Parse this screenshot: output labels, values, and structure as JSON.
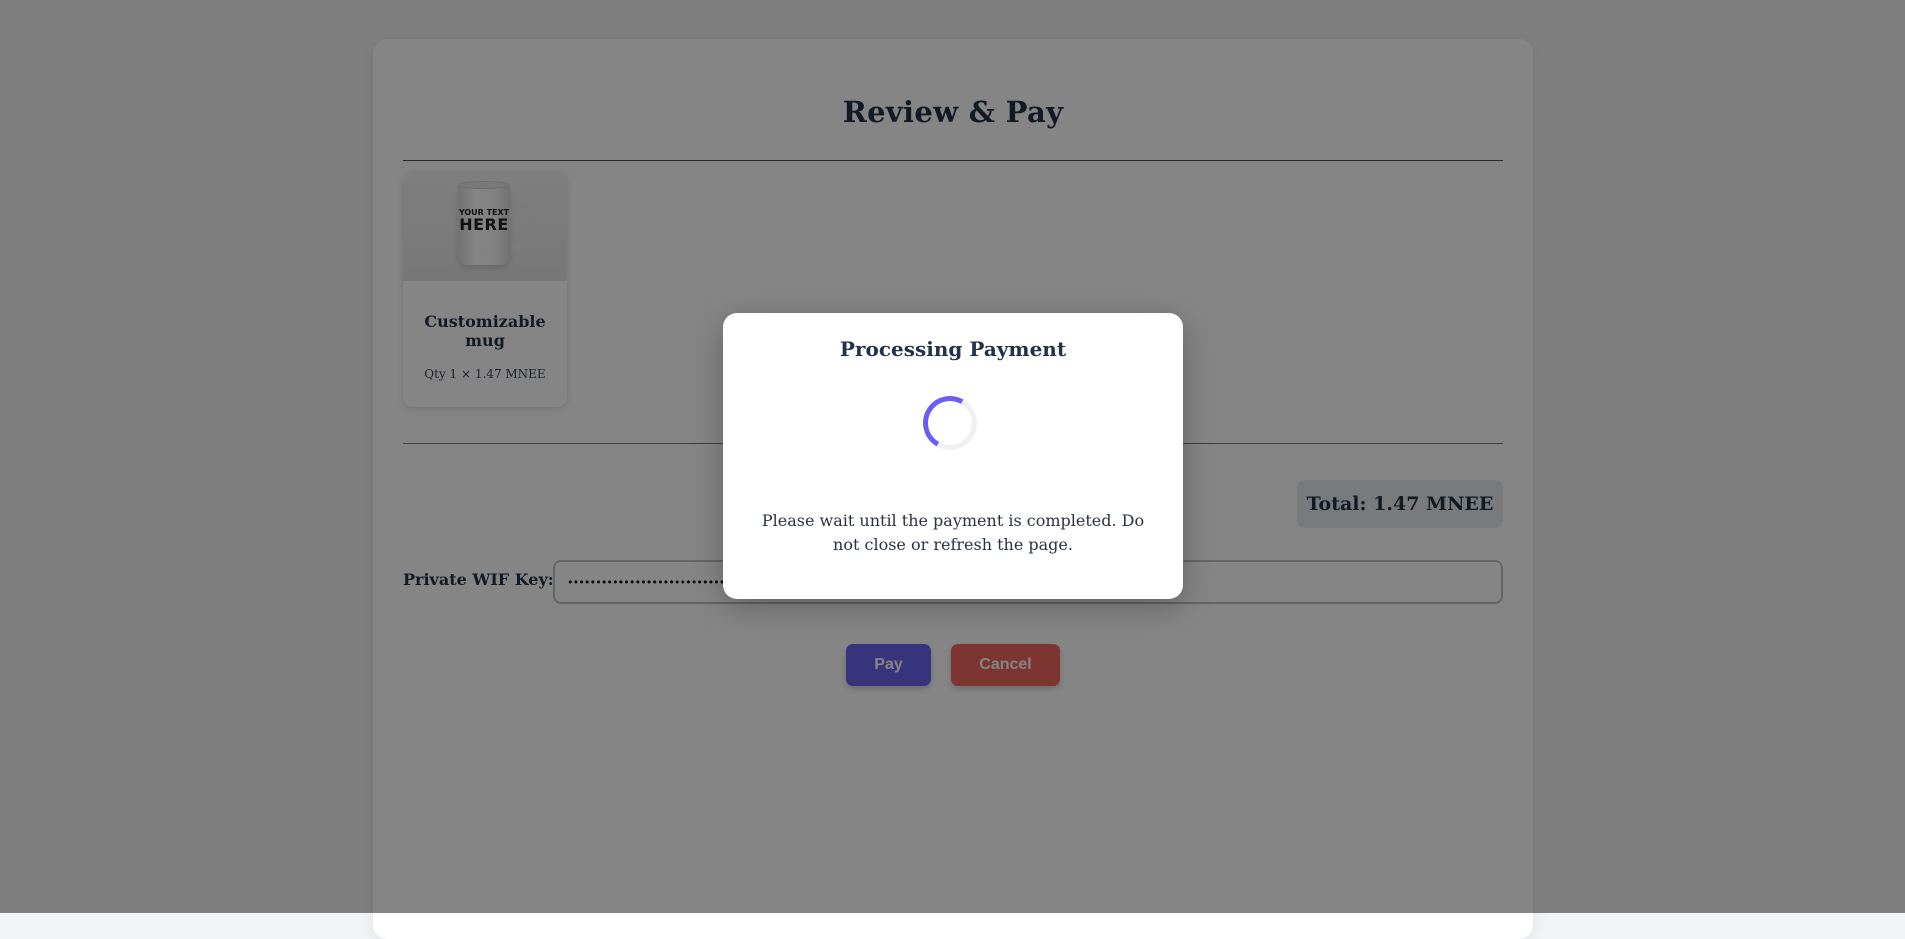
{
  "page": {
    "title": "Review & Pay"
  },
  "cart": {
    "items": [
      {
        "name": "Customizable mug",
        "qty_line": "Qty 1 × 1.47 MNEE",
        "image_text_line1": "YOUR TEXT",
        "image_text_line2": "HERE"
      }
    ],
    "total_label": "Total: 1.47 MNEE"
  },
  "payment_form": {
    "wif_label": "Private WIF Key:",
    "wif_value": "••••••••••••••••••••••••••••••••••••••••••••••••••••"
  },
  "actions": {
    "pay_label": "Pay",
    "cancel_label": "Cancel"
  },
  "modal": {
    "title": "Processing Payment",
    "message": "Please wait until the payment is completed. Do not close or refresh the page."
  },
  "colors": {
    "accent": "#6a63f0",
    "danger": "#f0675f",
    "spinner": "#6a5cf5"
  }
}
